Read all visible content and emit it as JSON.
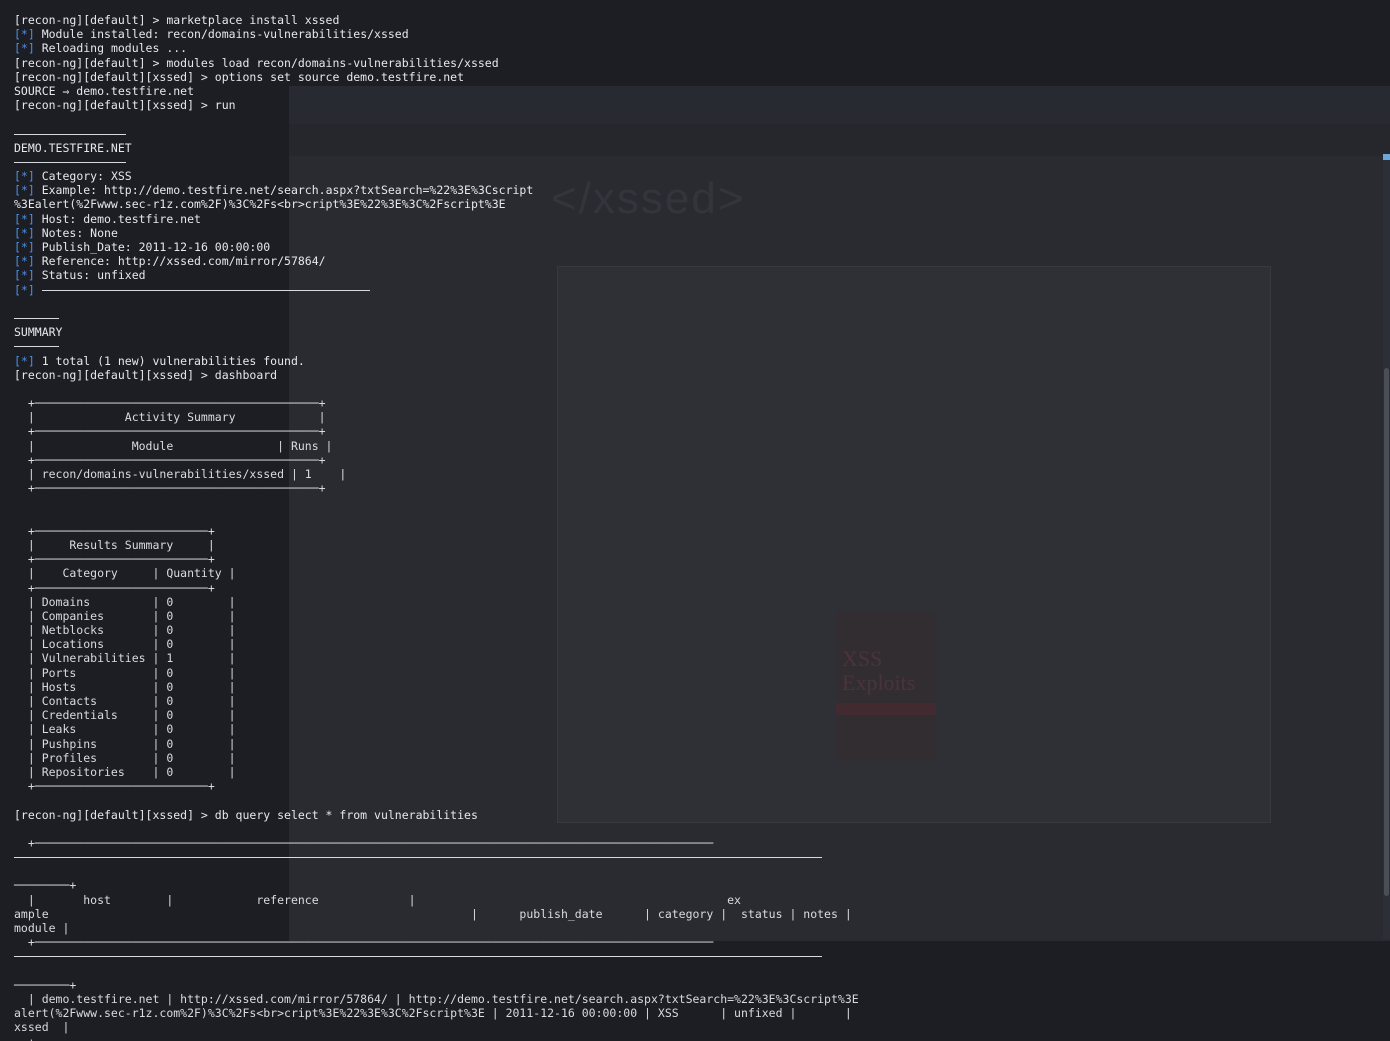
{
  "terminal": {
    "lines": [
      {
        "kind": "prompt",
        "text": "[recon-ng][default] > marketplace install xssed"
      },
      {
        "kind": "status",
        "tag": "[*]",
        "text": " Module installed: recon/domains-vulnerabilities/xssed"
      },
      {
        "kind": "status",
        "tag": "[*]",
        "text": " Reloading modules ..."
      },
      {
        "kind": "prompt",
        "text": "[recon-ng][default] > modules load recon/domains-vulnerabilities/xssed"
      },
      {
        "kind": "prompt",
        "text": "[recon-ng][default][xssed] > options set source demo.testfire.net"
      },
      {
        "kind": "plain",
        "text": "SOURCE ⇒ demo.testfire.net"
      },
      {
        "kind": "prompt",
        "text": "[recon-ng][default][xssed] > run"
      },
      {
        "kind": "blank"
      },
      {
        "kind": "rule",
        "width": 112
      },
      {
        "kind": "plain",
        "text": "DEMO.TESTFIRE.NET"
      },
      {
        "kind": "rule",
        "width": 112
      },
      {
        "kind": "status",
        "tag": "[*]",
        "text": " Category: XSS"
      },
      {
        "kind": "status",
        "tag": "[*]",
        "text": " Example: http://demo.testfire.net/search.aspx?txtSearch=%22%3E%3Cscript"
      },
      {
        "kind": "plain",
        "text": "%3Ealert(%2Fwww.sec-r1z.com%2F)%3C%2Fs<br>cript%3E%22%3E%3C%2Fscript%3E"
      },
      {
        "kind": "status",
        "tag": "[*]",
        "text": " Host: demo.testfire.net"
      },
      {
        "kind": "status",
        "tag": "[*]",
        "text": " Notes: None"
      },
      {
        "kind": "status",
        "tag": "[*]",
        "text": " Publish_Date: 2011-12-16 00:00:00"
      },
      {
        "kind": "status",
        "tag": "[*]",
        "text": " Reference: http://xssed.com/mirror/57864/"
      },
      {
        "kind": "status",
        "tag": "[*]",
        "text": " Status: unfixed"
      },
      {
        "kind": "status-rule",
        "tag": "[*]",
        "width": 328
      },
      {
        "kind": "blank"
      },
      {
        "kind": "rule",
        "width": 45
      },
      {
        "kind": "plain",
        "text": "SUMMARY"
      },
      {
        "kind": "rule",
        "width": 45
      },
      {
        "kind": "status",
        "tag": "[*]",
        "text": " 1 total (1 new) vulnerabilities found."
      },
      {
        "kind": "prompt",
        "text": "[recon-ng][default][xssed] > dashboard"
      },
      {
        "kind": "blank"
      },
      {
        "kind": "table",
        "text": "  +─────────────────────────────────────────+"
      },
      {
        "kind": "table",
        "text": "  |             Activity Summary            |"
      },
      {
        "kind": "table",
        "text": "  +─────────────────────────────────────────+"
      },
      {
        "kind": "table",
        "text": "  |              Module               | Runs |"
      },
      {
        "kind": "table",
        "text": "  +─────────────────────────────────────────+"
      },
      {
        "kind": "table",
        "text": "  | recon/domains-vulnerabilities/xssed | 1    |"
      },
      {
        "kind": "table",
        "text": "  +─────────────────────────────────────────+"
      },
      {
        "kind": "blank"
      },
      {
        "kind": "blank"
      },
      {
        "kind": "table",
        "text": "  +─────────────────────────+"
      },
      {
        "kind": "table",
        "text": "  |     Results Summary     |"
      },
      {
        "kind": "table",
        "text": "  +─────────────────────────+"
      },
      {
        "kind": "table",
        "text": "  |    Category     | Quantity |"
      },
      {
        "kind": "table",
        "text": "  +─────────────────────────+"
      },
      {
        "kind": "table",
        "text": "  | Domains         | 0        |"
      },
      {
        "kind": "table",
        "text": "  | Companies       | 0        |"
      },
      {
        "kind": "table",
        "text": "  | Netblocks       | 0        |"
      },
      {
        "kind": "table",
        "text": "  | Locations       | 0        |"
      },
      {
        "kind": "table",
        "text": "  | Vulnerabilities | 1        |"
      },
      {
        "kind": "table",
        "text": "  | Ports           | 0        |"
      },
      {
        "kind": "table",
        "text": "  | Hosts           | 0        |"
      },
      {
        "kind": "table",
        "text": "  | Contacts        | 0        |"
      },
      {
        "kind": "table",
        "text": "  | Credentials     | 0        |"
      },
      {
        "kind": "table",
        "text": "  | Leaks           | 0        |"
      },
      {
        "kind": "table",
        "text": "  | Pushpins        | 0        |"
      },
      {
        "kind": "table",
        "text": "  | Profiles        | 0        |"
      },
      {
        "kind": "table",
        "text": "  | Repositories    | 0        |"
      },
      {
        "kind": "table",
        "text": "  +─────────────────────────+"
      },
      {
        "kind": "blank"
      },
      {
        "kind": "prompt",
        "text": "[recon-ng][default][xssed] > db query select * from vulnerabilities"
      },
      {
        "kind": "blank"
      },
      {
        "kind": "table",
        "text": "  +──────────────────────────────────────────────────────────────────────────────────────────────────"
      },
      {
        "kind": "rule",
        "width": 808
      },
      {
        "kind": "blank"
      },
      {
        "kind": "table",
        "text": "────────+"
      },
      {
        "kind": "table",
        "text": "  |       host        |            reference             |                                             ex"
      },
      {
        "kind": "table",
        "text": "ample                                                             |      publish_date      | category |  status | notes |"
      },
      {
        "kind": "table",
        "text": "module |"
      },
      {
        "kind": "table",
        "text": "  +──────────────────────────────────────────────────────────────────────────────────────────────────"
      },
      {
        "kind": "rule",
        "width": 808
      },
      {
        "kind": "blank"
      },
      {
        "kind": "table",
        "text": "────────+"
      },
      {
        "kind": "table",
        "text": "  | demo.testfire.net | http://xssed.com/mirror/57864/ | http://demo.testfire.net/search.aspx?txtSearch=%22%3E%3Cscript%3E"
      },
      {
        "kind": "table",
        "text": "alert(%2Fwww.sec-r1z.com%2F)%3C%2Fs<br>cript%3E%22%3E%3C%2Fscript%3E | 2011-12-16 00:00:00 | XSS      | unfixed |       |"
      },
      {
        "kind": "table",
        "text": "xssed  |"
      },
      {
        "kind": "table",
        "text": "  +──────────────────────────────────────────────────────────────────────────────────────────────────"
      }
    ]
  },
  "colors": {
    "background": "#1c1e24",
    "text": "#e6e8ec",
    "status_tag": "#4f8fe0"
  }
}
